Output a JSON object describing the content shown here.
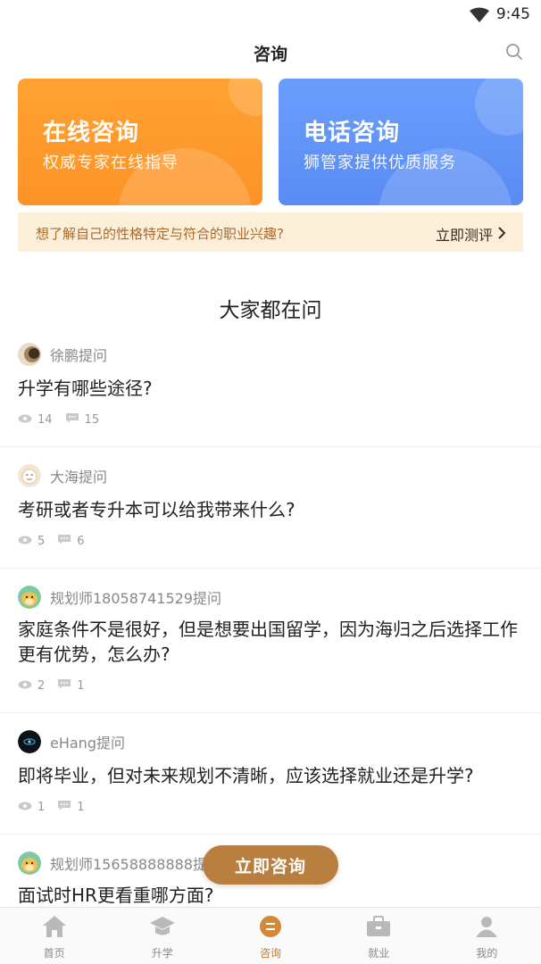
{
  "status_bar": {
    "time": "9:45"
  },
  "header": {
    "title": "咨询"
  },
  "cards": [
    {
      "title": "在线咨询",
      "subtitle": "权威专家在线指导",
      "color": "#fd9a2c"
    },
    {
      "title": "电话咨询",
      "subtitle": "狮管家提供优质服务",
      "color": "#6294f8"
    }
  ],
  "banner": {
    "text": "想了解自己的性格特定与符合的职业兴趣?",
    "cta": "立即测评"
  },
  "section_title": "大家都在问",
  "questions": [
    {
      "asker": "徐鹏提问",
      "question": "升学有哪些途径?",
      "views": "14",
      "comments": "15"
    },
    {
      "asker": "大海提问",
      "question": "考研或者专升本可以给我带来什么?",
      "views": "5",
      "comments": "6"
    },
    {
      "asker": "规划师18058741529提问",
      "question": "家庭条件不是很好，但是想要出国留学，因为海归之后选择工作更有优势，怎么办?",
      "views": "2",
      "comments": "1"
    },
    {
      "asker": "eHang提问",
      "question": "即将毕业，但对未来规划不清晰，应该选择就业还是升学?",
      "views": "1",
      "comments": "1"
    },
    {
      "asker": "规划师15658888888提问",
      "question": "面试时HR更看重哪方面?"
    }
  ],
  "float_button": "立即咨询",
  "tabs": [
    {
      "label": "首页",
      "icon": "home-icon"
    },
    {
      "label": "升学",
      "icon": "graduation-cap-icon"
    },
    {
      "label": "咨询",
      "icon": "consult-icon"
    },
    {
      "label": "就业",
      "icon": "briefcase-icon"
    },
    {
      "label": "我的",
      "icon": "person-icon"
    }
  ],
  "colors": {
    "accent": "#c47a2c",
    "button": "#b87f3f",
    "banner_bg": "#fcefd9"
  }
}
